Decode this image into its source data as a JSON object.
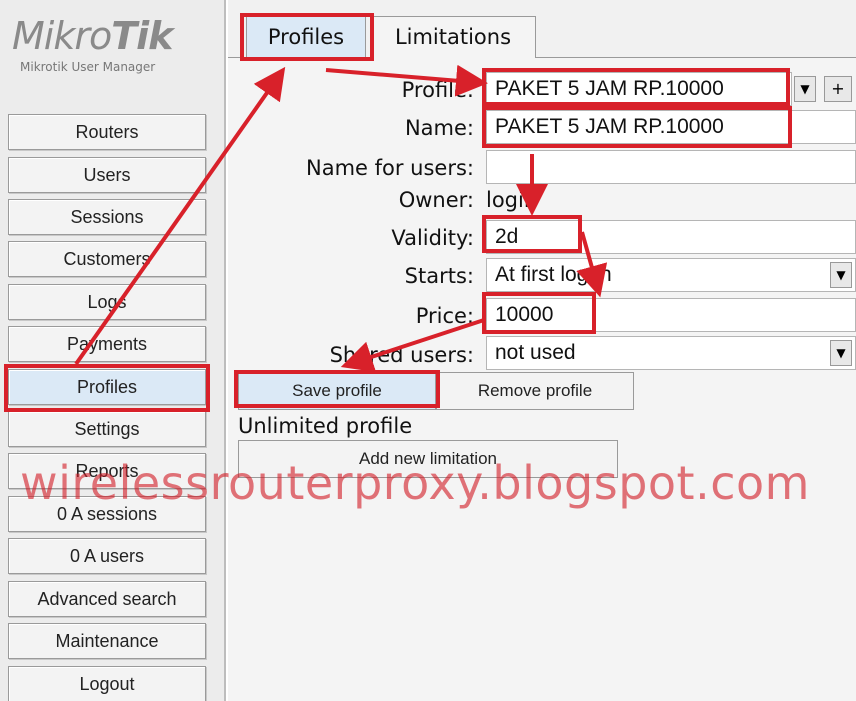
{
  "logo": {
    "brand_regular": "Mikro",
    "brand_bold": "Tik",
    "subtitle": "Mikrotik User Manager"
  },
  "sidebar": {
    "items": [
      {
        "label": "Routers"
      },
      {
        "label": "Users"
      },
      {
        "label": "Sessions"
      },
      {
        "label": "Customers"
      },
      {
        "label": "Logs"
      },
      {
        "label": "Payments"
      },
      {
        "label": "Profiles",
        "active": true
      },
      {
        "label": "Settings"
      },
      {
        "label": "Reports"
      },
      {
        "label": "0 A sessions"
      },
      {
        "label": "0 A users"
      },
      {
        "label": "Advanced search"
      },
      {
        "label": "Maintenance"
      },
      {
        "label": "Logout"
      }
    ]
  },
  "tabs": [
    {
      "label": "Profiles",
      "active": true
    },
    {
      "label": "Limitations"
    }
  ],
  "form": {
    "profile_label": "Profile:",
    "profile_value": "PAKET 5 JAM RP.10000",
    "add_symbol": "+",
    "name_label": "Name:",
    "name_value": "PAKET 5 JAM RP.10000",
    "name_for_users_label": "Name for users:",
    "name_for_users_value": "",
    "owner_label": "Owner:",
    "owner_value": "login",
    "validity_label": "Validity:",
    "validity_value": "2d",
    "starts_label": "Starts:",
    "starts_value": "At first logon",
    "price_label": "Price:",
    "price_value": "10000",
    "shared_users_label": "Shared users:",
    "shared_users_value": "not used",
    "save_label": "Save profile",
    "remove_label": "Remove profile",
    "unlimited_label": "Unlimited profile",
    "add_limitation_label": "Add new limitation"
  },
  "watermark": "wirelessrouterproxy.blogspot.com",
  "colors": {
    "annotation_red": "#d8212a",
    "active_blue": "#dbe9f6"
  }
}
